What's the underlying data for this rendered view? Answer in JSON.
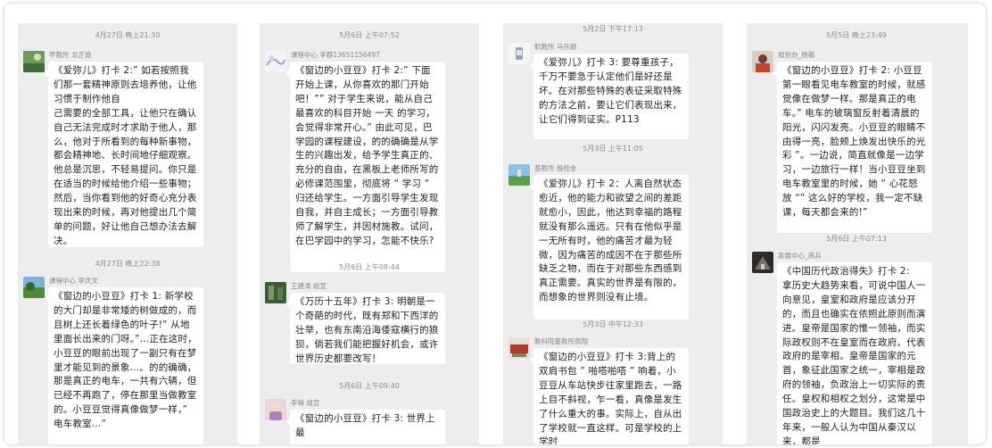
{
  "panels": [
    {
      "messages": [
        {
          "time": "4月27日 晚上21:30",
          "sender": "早教所 龙正谕",
          "text": "《爱弥儿》打卡 2:” 如若按照我们那一套精神原则去培养他，让他习惯于制作他自\n己需要的全部工具，让他只在确认自己无法完成时才求助于他人，那么，他对于所看到的每种新事物，都会精神地、长时间地仔细观察。他总是沉思，不轻易提问。你只是在适当的时候给他介绍一些事物；然后，当你看到他的好奇心充分表现出来的时候，再对他提出几个简单的问题，好让他自己想办法去解决。"
        },
        {
          "time": "4月27日 晚上22:38",
          "sender": "课程中心 李庆文",
          "text": "《窗边的小豆豆》打卡 1: 新学校的大门却是非常矮的树做成的，而且树上还长着绿色的叶子!” 从地里面长出来的门呀。”…正在这时，小豆豆的眼前出现了一副只有在梦里才能见到的景象…。的的确确，那是真正的电车，一共有六辆，但已经不再跑了，停在那里当做教室的。小豆豆觉得真像做梦一样，” 电车教室…”"
        }
      ]
    },
    {
      "messages": [
        {
          "time": "5月6日 上午07:52",
          "sender": "课程中心 李群13651156497",
          "text": "《窗边的小豆豆》打卡 2:” 下面开始上课，从你喜欢的那门开始吧！”” 对于学生来说，能从自己最喜欢的科目开始 一天 的学习，会觉得非常开心。” 由此可见，巴学园的课程建设，的的确确是从学生的兴趣出发，给予学生真正的、充分的自由，在黑板上老师所写的必修课范围里，彻底将 “ 学习 ” 归还给学生。一方面引导学生发现自我，并自主成长；一方面引导教师了解学生，并因材施教。试问，在巴学园中的学习，怎能不快乐?"
        },
        {
          "time": "5月6日 上午08:44",
          "sender": "王建涛 组宣",
          "text": "《万历十五年》打卡 3: 明朝是一个奇葩的时代，既有郑和下西洋的壮举，也有东南沿海倭寇横行的狼狈，倘若我们能把握好机会，或许世界历史都要改写！"
        },
        {
          "time": "5月6日 上午09:40",
          "sender": "李琳 组宣",
          "text": "《窗边的小豆豆》打卡 3: 世界上最"
        }
      ]
    },
    {
      "messages": [
        {
          "time": "5月2日 下午17:13",
          "sender": "职教所 马开颜",
          "text": "《爱弥儿》打卡 3: 要尊重孩子，千万不要急于认定他们是好还是坏。在对那些特殊的表征采取特殊的方法之前，要让它们表现出来，让它们得到证实。P113"
        },
        {
          "time": "5月3日 上午11:05",
          "sender": "基教所 殷桂金",
          "text": "《爱弥儿》打卡 2：人离自然状态愈近，他的能力和欲望之间的差距就愈小，因此，他达到幸福的路程就没有那么遥远。只有在他似乎是一无所有时，他的痛苦才最为轻微，因为痛苦的成因不在于那些所缺乏之物，而在于对那些东西感到真正需要。真实的世界是有限的，而想象的世界则没有止境。"
        },
        {
          "time": "5月3日 中午12:33",
          "sender": "教科院基教所高翔",
          "text": "《窗边的小豆豆》打卡 3:背上的双肩书包 ” 啪嗒啪嗒 ” 响着，小豆豆从车站快步往家里跑去，一路上目不斜视，乍一看，真像是发生了什么重大的事。实际上，自从出了学校就一直这样。可是学校的上学时"
        }
      ]
    },
    {
      "messages": [
        {
          "time": "5月5日 晚上23:49",
          "sender": "规划办_杨薇",
          "text": "《窗边的小豆豆》打卡 2: 小豆豆第一眼看见电车教室的时候，就感觉像在做梦一样。那是真正的电车。” 电车的玻璃窗反射着清晨的阳光，闪闪发亮。小豆豆的眼睛不由得一亮，脸颊上焕发出快乐的光彩 ”。一边说，简直就像是一边学习，一边旅行一样！当小豆豆坐到电车教室里的时候，她 ” 心花怒放 “” 这么好的学校，我一定不缺课，每天都会来的!”"
        },
        {
          "time": "5月6日 上午07:13",
          "sender": "发展中心_高兵",
          "text": "《中国历代政治得失》打卡 2:\n拿历史大趋势来看，可说中国人一向意见，皇室和政府是应该分开的，而且也确实在依照此原则而演进。皇帝是国家的惟一领袖，而实际政权则不在皇室而在政府。代表政府的是宰相。皇帝是国家的元首，象征此国家之统一，宰相是政府的领袖，负政治上一切实际的责任。皇权和相权之划分，这常是中国政治史上的大题目。我们这几十年来，一般人认为中国从秦汉以来，都是"
        }
      ]
    }
  ]
}
